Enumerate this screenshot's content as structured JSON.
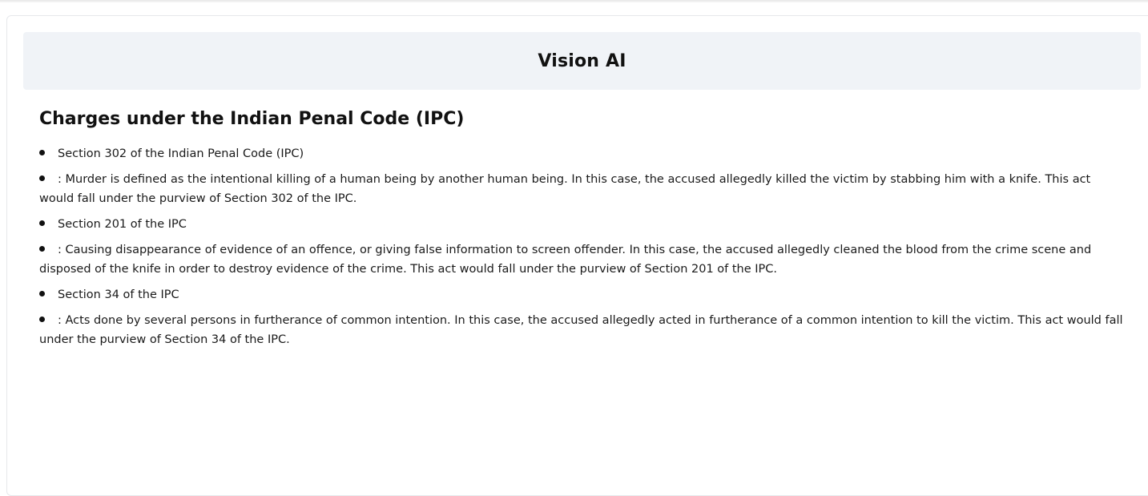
{
  "app": {
    "title": "Vision AI"
  },
  "main": {
    "heading": "Charges under the Indian Penal Code (IPC)",
    "items": [
      {
        "text": "Section 302 of the Indian Penal Code (IPC)"
      },
      {
        "text": ": Murder is defined as the intentional killing of a human being by another human being. In this case, the accused allegedly killed the victim by stabbing him with a knife. This act would fall under the purview of Section 302 of the IPC."
      },
      {
        "text": "Section 201 of the IPC"
      },
      {
        "text": ": Causing disappearance of evidence of an offence, or giving false information to screen offender. In this case, the accused allegedly cleaned the blood from the crime scene and disposed of the knife in order to destroy evidence of the crime. This act would fall under the purview of Section 201 of the IPC."
      },
      {
        "text": "Section 34 of the IPC"
      },
      {
        "text": ": Acts done by several persons in furtherance of common intention. In this case, the accused allegedly acted in furtherance of a common intention to kill the victim. This act would fall under the purview of Section 34 of the IPC."
      }
    ]
  }
}
